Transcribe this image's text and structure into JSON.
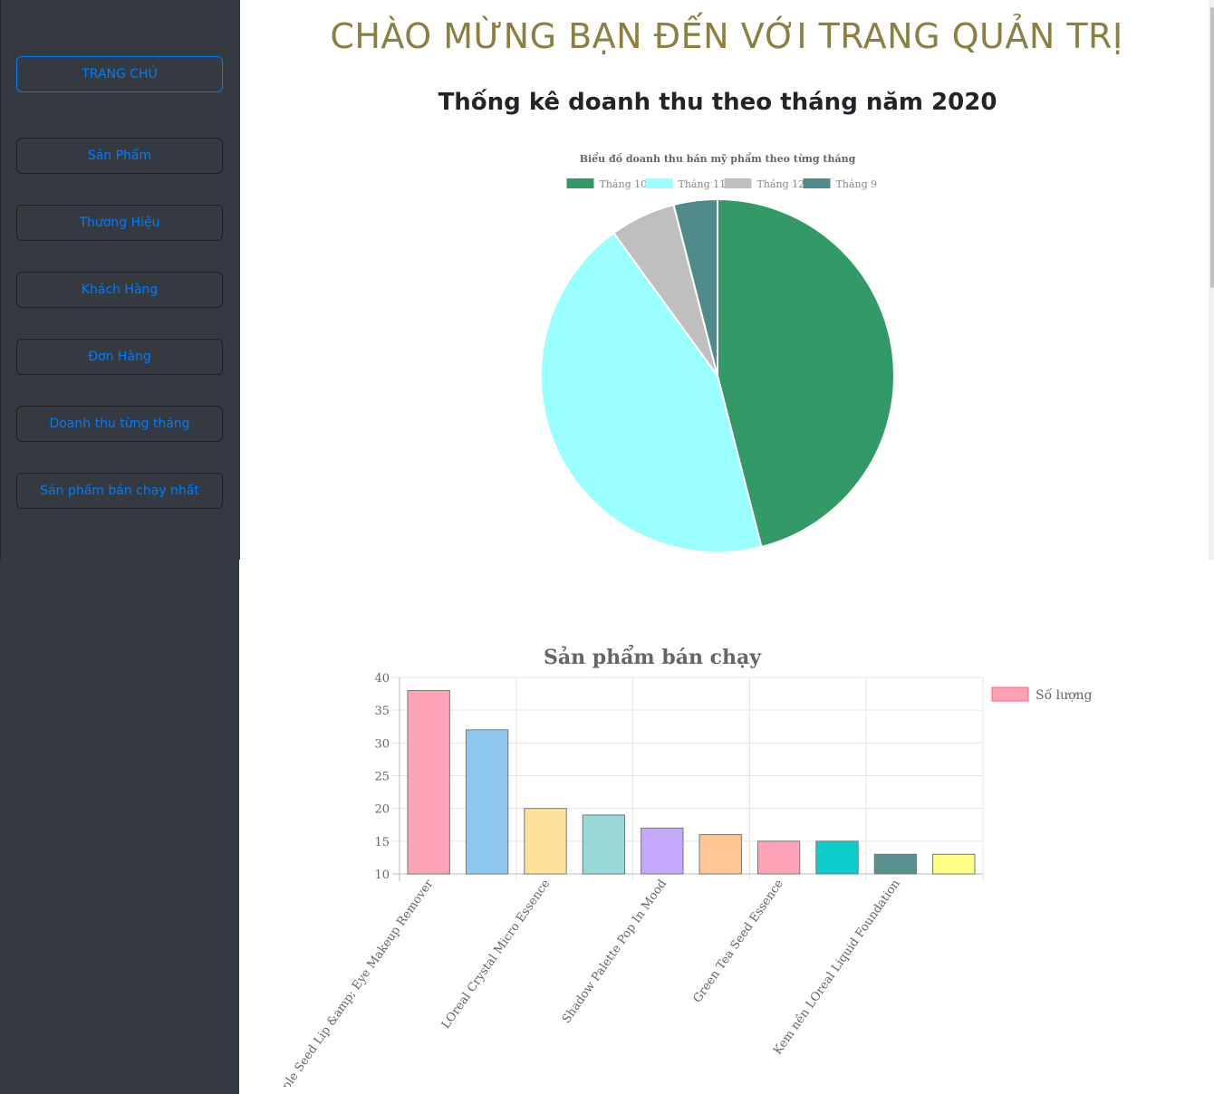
{
  "sidebar": {
    "items": [
      {
        "label": "TRANG CHỦ",
        "active": true
      },
      {
        "label": "Sản Phẩm"
      },
      {
        "label": "Thương Hiệu"
      },
      {
        "label": "Khách Hàng"
      },
      {
        "label": "Đơn Hàng"
      },
      {
        "label": "Doanh thu từng tháng"
      },
      {
        "label": "Sản phẩm bán chạy nhất"
      }
    ]
  },
  "header": {
    "title": "CHÀO MỪNG BẠN ĐẾN VỚI TRANG QUẢN TRỊ",
    "subtitle": "Thống kê doanh thu theo tháng năm 2020"
  },
  "colors": {
    "sidebar_bg": "#343a40",
    "link": "#007bff",
    "title": "#8c8040"
  },
  "chart_data": [
    {
      "type": "pie",
      "title": "Biểu đồ doanh thu bán mỹ phẩm theo từng tháng",
      "legend_position": "top",
      "categories": [
        "Tháng 10",
        "Tháng 11",
        "Tháng 12",
        "Tháng 9"
      ],
      "values": [
        46,
        44,
        6,
        4
      ],
      "colors": [
        "#339966",
        "#99ffff",
        "#bfbfbf",
        "#518a8a"
      ]
    },
    {
      "type": "bar",
      "title": "Sản phẩm bán chạy",
      "legend_position": "right",
      "categories": [
        "Apple Seed Lip &amp; Eye Makeup Remover",
        "",
        "LOreal Crystal Micro Essence",
        "",
        "Shadow Palette Pop In Mood",
        "",
        "Green Tea Seed Essence",
        "",
        "Kem nền LOreal Liquid Foundation",
        ""
      ],
      "series": [
        {
          "name": "Số lượng",
          "values": [
            38,
            32,
            20,
            19,
            17,
            16,
            15,
            15,
            13,
            13
          ]
        }
      ],
      "bar_colors": [
        "#ff9fb3",
        "#87c5f2",
        "#ffdf97",
        "#92d6d6",
        "#c3a3fc",
        "#ffc48f",
        "#ff9fb3",
        "#00c9c9",
        "#4f8a8a",
        "#ffff80"
      ],
      "ylim": [
        10,
        40
      ],
      "yticks": [
        10,
        15,
        20,
        25,
        30,
        35,
        40
      ],
      "grid": true
    }
  ]
}
